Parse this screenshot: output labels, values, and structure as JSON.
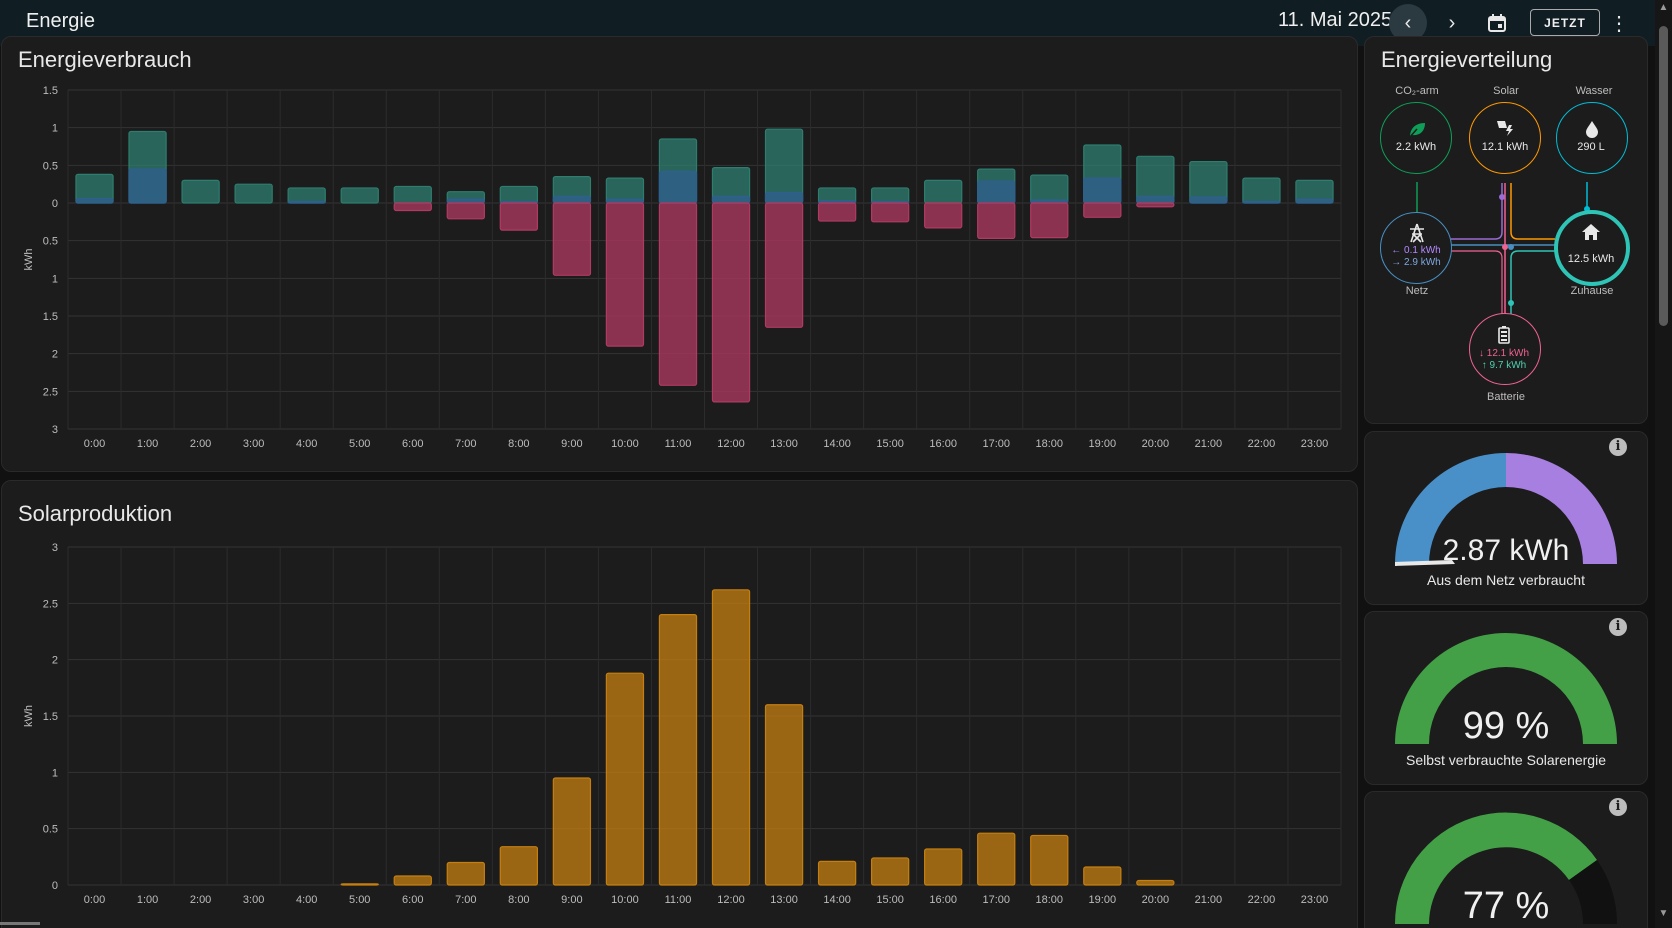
{
  "header": {
    "title": "Energie",
    "date": "11. Mai 2025",
    "prev_icon": "‹",
    "next_icon": "›",
    "calendar_icon": "calendar-icon",
    "now_label": "JETZT",
    "menu_icon": "⋮"
  },
  "consumption": {
    "title": "Energieverbrauch",
    "ylabel": "kWh"
  },
  "solar": {
    "title": "Solarproduktion",
    "ylabel": "kWh"
  },
  "chart_data": [
    {
      "type": "bar",
      "title": "Energieverbrauch",
      "ylabel": "kWh",
      "categories": [
        "0:00",
        "1:00",
        "2:00",
        "3:00",
        "4:00",
        "5:00",
        "6:00",
        "7:00",
        "8:00",
        "9:00",
        "10:00",
        "11:00",
        "12:00",
        "13:00",
        "14:00",
        "15:00",
        "16:00",
        "17:00",
        "18:00",
        "19:00",
        "20:00",
        "21:00",
        "22:00",
        "23:00"
      ],
      "ylim": [
        -3,
        1.5
      ],
      "yticks": [
        1.5,
        1,
        0.5,
        0,
        -0.5,
        -1,
        -1.5,
        -2,
        -2.5,
        -3
      ],
      "ytick_labels": [
        "1.5",
        "1",
        "0.5",
        "0",
        "0.5",
        "1",
        "1.5",
        "2",
        "2.5",
        "3"
      ],
      "grid": true,
      "series": [
        {
          "color": "#2e7d6f",
          "values": [
            0.38,
            0.95,
            0.3,
            0.25,
            0.2,
            0.2,
            0.22,
            0.15,
            0.22,
            0.35,
            0.33,
            0.85,
            0.47,
            0.98,
            0.2,
            0.2,
            0.3,
            0.45,
            0.37,
            0.77,
            0.62,
            0.55,
            0.33,
            0.3
          ]
        },
        {
          "color": "#2f5f8f",
          "values": [
            0.06,
            0.45,
            0,
            0,
            0.02,
            0,
            0,
            0.05,
            0.02,
            0.09,
            0.05,
            0.42,
            0.09,
            0.14,
            0.03,
            0.02,
            0,
            0.29,
            0.04,
            0.33,
            0.09,
            0.08,
            0.02,
            0.05
          ]
        },
        {
          "color": "#b03a62",
          "values": [
            0,
            0,
            0,
            0,
            0,
            0,
            -0.1,
            -0.21,
            -0.36,
            -0.96,
            -1.9,
            -2.42,
            -2.64,
            -1.65,
            -0.24,
            -0.25,
            -0.33,
            -0.47,
            -0.46,
            -0.19,
            -0.05,
            0,
            0,
            0
          ]
        }
      ]
    },
    {
      "type": "bar",
      "title": "Solarproduktion",
      "ylabel": "kWh",
      "categories": [
        "0:00",
        "1:00",
        "2:00",
        "3:00",
        "4:00",
        "5:00",
        "6:00",
        "7:00",
        "8:00",
        "9:00",
        "10:00",
        "11:00",
        "12:00",
        "13:00",
        "14:00",
        "15:00",
        "16:00",
        "17:00",
        "18:00",
        "19:00",
        "20:00",
        "21:00",
        "22:00",
        "23:00"
      ],
      "ylim": [
        0,
        3
      ],
      "yticks": [
        0,
        0.5,
        1,
        1.5,
        2,
        2.5,
        3
      ],
      "grid": true,
      "series": [
        {
          "color": "#c57f10",
          "values": [
            0,
            0,
            0,
            0,
            0,
            0.01,
            0.08,
            0.2,
            0.34,
            0.95,
            1.88,
            2.4,
            2.62,
            1.6,
            0.21,
            0.24,
            0.32,
            0.46,
            0.44,
            0.16,
            0.04,
            0,
            0,
            0
          ]
        }
      ]
    }
  ],
  "distribution": {
    "title": "Energieverteilung",
    "lowcarbon": {
      "label": "CO₂-arm",
      "value": "2.2 kWh",
      "icon": "leaf-icon",
      "color": "#0f9d58"
    },
    "solar": {
      "label": "Solar",
      "value": "12.1 kWh",
      "icon": "solar-power-icon",
      "color": "#ff9800"
    },
    "water": {
      "label": "Wasser",
      "value": "290 L",
      "icon": "water-drop-icon",
      "color": "#00bcd4"
    },
    "grid": {
      "label": "Netz",
      "in": "0.1 kWh",
      "out": "2.9 kWh",
      "icon": "transmission-tower-icon",
      "color": "#488fc2"
    },
    "home": {
      "label": "Zuhause",
      "value": "12.5 kWh",
      "icon": "home-icon",
      "color": "#2ec4b6"
    },
    "battery": {
      "label": "Batterie",
      "in": "12.1 kWh",
      "out": "9.7 kWh",
      "icon": "battery-icon",
      "color": "#f06292"
    }
  },
  "gauges": [
    {
      "value": "2.87 kWh",
      "label": "Aus dem Netz verbraucht",
      "fraction": 0.5,
      "info_icon": "i"
    },
    {
      "value": "99 %",
      "label": "Selbst verbrauchte Solarenergie",
      "fraction": 0.99,
      "info_icon": "i"
    },
    {
      "value": "77 %",
      "label": "",
      "fraction": 0.77,
      "info_icon": "i"
    }
  ]
}
